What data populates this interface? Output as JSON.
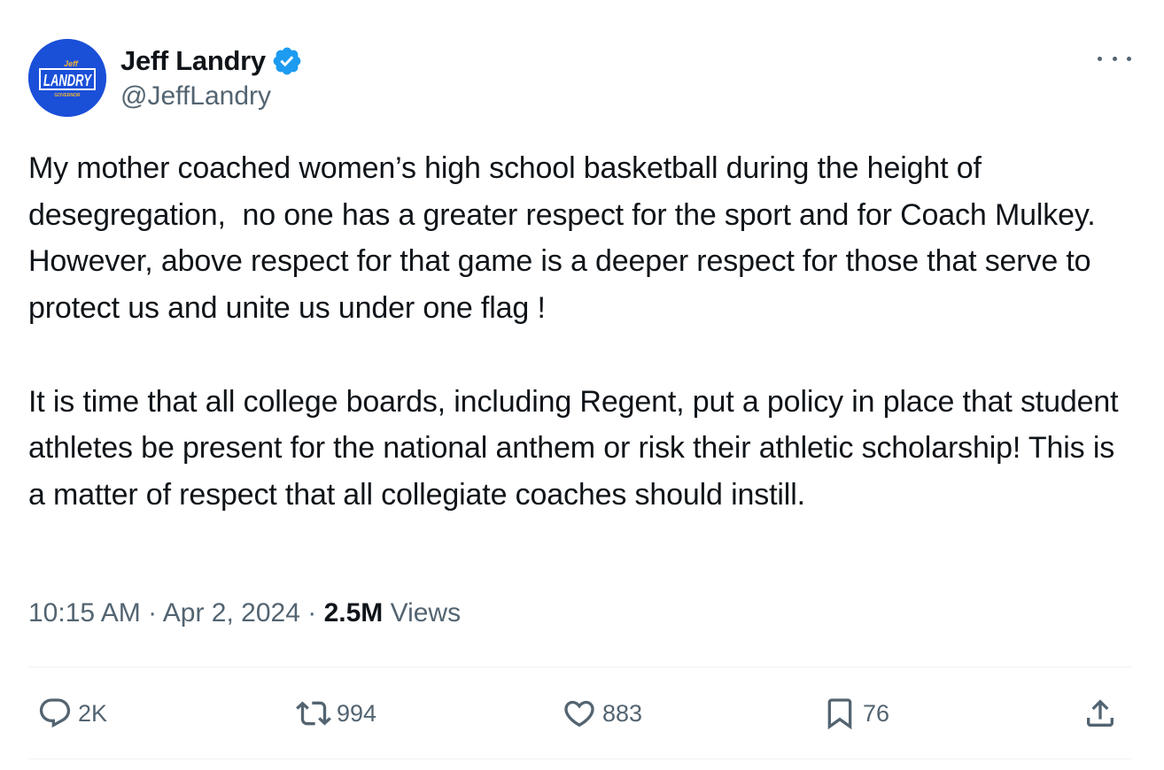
{
  "author": {
    "display_name": "Jeff Landry",
    "handle": "@JeffLandry",
    "verified": true,
    "avatar": {
      "logo_text_small": "Jeff",
      "logo_text_main": "LANDRY",
      "logo_text_sub": "GOVERNOR",
      "background_color": "#1a4fd8"
    }
  },
  "more_menu_icon": "more-horizontal-icon",
  "tweet": {
    "paragraphs": [
      "My mother coached women’s high school basketball during the height of desegregation,  no one has a greater respect for the sport and for Coach Mulkey. However, above respect for that game is a deeper respect for those that serve to protect us and unite us under one flag !",
      "It is time that all college boards, including Regent, put a policy in place that student athletes be present for the national anthem or risk their athletic scholarship! This is a matter of respect that all collegiate coaches should instill."
    ]
  },
  "meta": {
    "time": "10:15 AM",
    "separator": " · ",
    "date": "Apr 2, 2024",
    "views_count": "2.5M",
    "views_label": " Views"
  },
  "actions": {
    "reply": {
      "icon": "reply-icon",
      "count": "2K"
    },
    "retweet": {
      "icon": "retweet-icon",
      "count": "994"
    },
    "like": {
      "icon": "heart-icon",
      "count": "883"
    },
    "bookmark": {
      "icon": "bookmark-icon",
      "count": "76"
    },
    "share": {
      "icon": "share-icon"
    }
  },
  "colors": {
    "text_primary": "#0f1419",
    "text_secondary": "#536471",
    "verified_badge": "#1d9bf0",
    "divider": "#eff3f4"
  }
}
